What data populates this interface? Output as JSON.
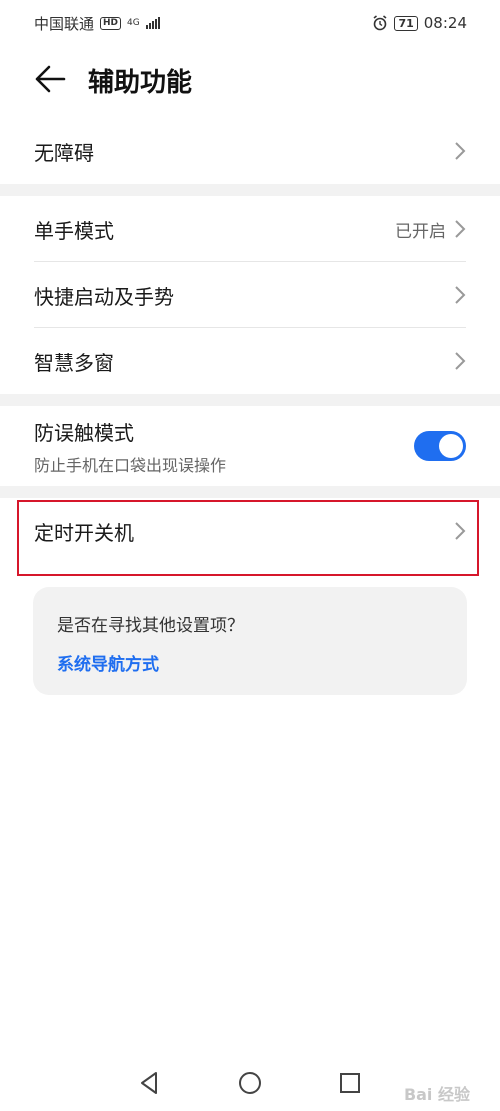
{
  "status_bar": {
    "carrier": "中国联通",
    "hd_badge": "HD",
    "network": "4G",
    "battery": "71",
    "time": "08:24"
  },
  "header": {
    "title": "辅助功能"
  },
  "groups": {
    "g1": {
      "items": [
        {
          "label": "无障碍"
        }
      ]
    },
    "g2": {
      "items": [
        {
          "label": "单手模式",
          "value": "已开启"
        },
        {
          "label": "快捷启动及手势"
        },
        {
          "label": "智慧多窗"
        }
      ]
    },
    "g3": {
      "toggle": {
        "label": "防误触模式",
        "sublabel": "防止手机在口袋出现误操作",
        "on": true
      }
    },
    "g4": {
      "items": [
        {
          "label": "定时开关机"
        }
      ]
    }
  },
  "suggest": {
    "question": "是否在寻找其他设置项？",
    "link": "系统导航方式"
  },
  "watermark": "Bai 经验",
  "colors": {
    "accent": "#1f6ef0",
    "highlight": "#d6172b",
    "section_gap": "#f2f2f2"
  }
}
